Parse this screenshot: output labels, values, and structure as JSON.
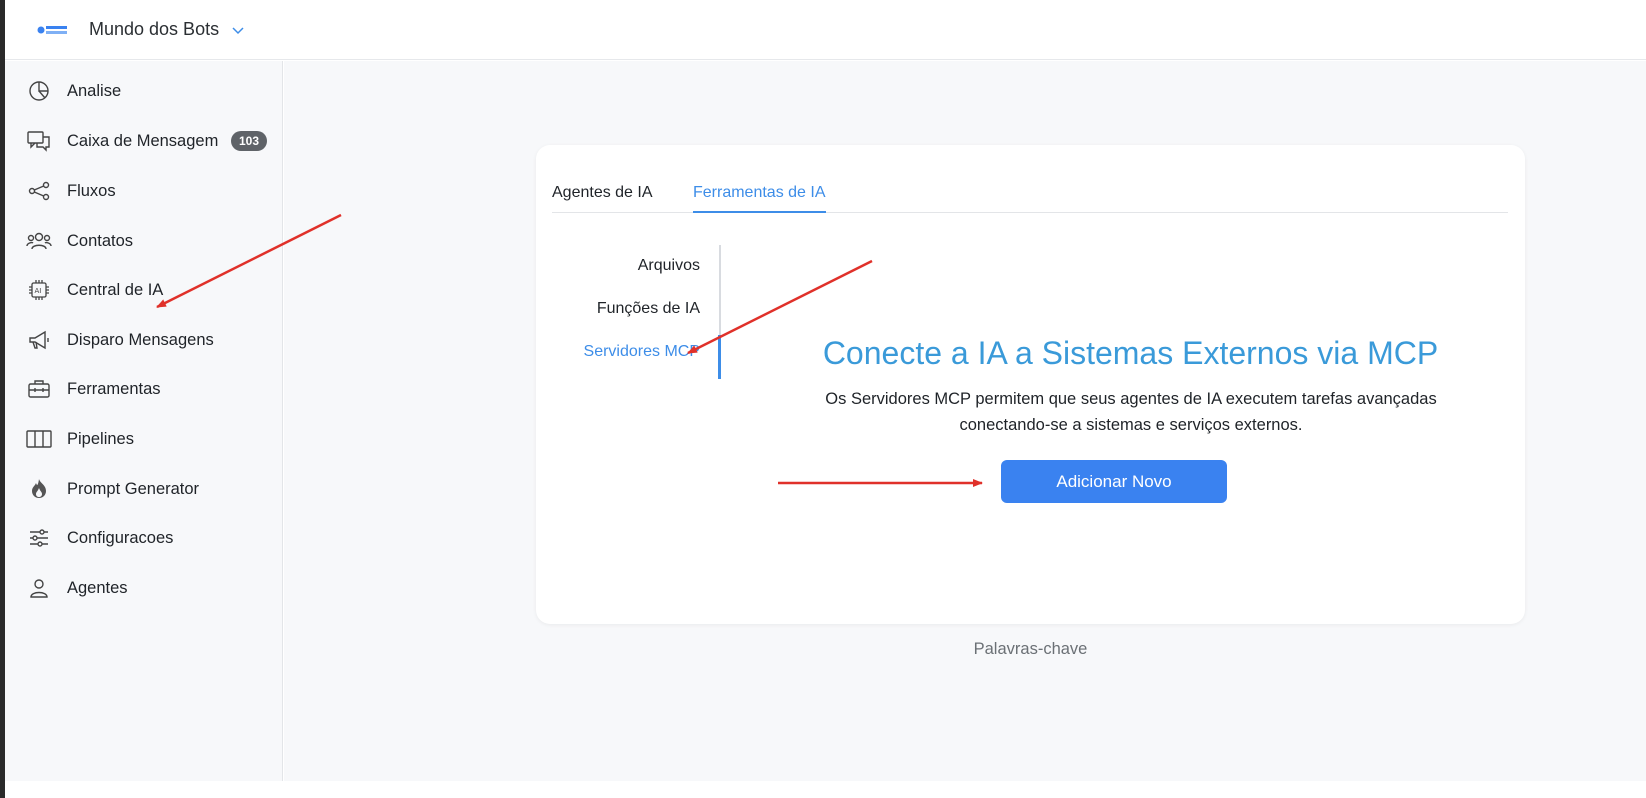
{
  "header": {
    "brand": "Mundo dos Bots",
    "logo_icon": "mundo-dos-bots-logo",
    "chevron_icon": "chevron-down-icon",
    "accent_color": "#3d8de8"
  },
  "sidebar": {
    "items": [
      {
        "label": "Analise",
        "icon": "pie-chart-icon"
      },
      {
        "label": "Caixa de Mensagem",
        "icon": "chat-bubbles-icon",
        "badge": "103"
      },
      {
        "label": "Fluxos",
        "icon": "flow-icon"
      },
      {
        "label": "Contatos",
        "icon": "contacts-icon"
      },
      {
        "label": "Central de IA",
        "icon": "ai-chip-icon"
      },
      {
        "label": "Disparo Mensagens",
        "icon": "megaphone-icon"
      },
      {
        "label": "Ferramentas",
        "icon": "toolbox-icon"
      },
      {
        "label": "Pipelines",
        "icon": "columns-icon"
      },
      {
        "label": "Prompt Generator",
        "icon": "flame-icon"
      },
      {
        "label": "Configuracoes",
        "icon": "sliders-icon"
      },
      {
        "label": "Agentes",
        "icon": "user-icon"
      }
    ]
  },
  "main": {
    "tabs": [
      {
        "label": "Agentes de IA",
        "active": false
      },
      {
        "label": "Ferramentas de IA",
        "active": true
      }
    ],
    "subnav": [
      {
        "label": "Arquivos",
        "active": false
      },
      {
        "label": "Funções de IA",
        "active": false
      },
      {
        "label": "Servidores MCP",
        "active": true
      }
    ],
    "headline": "Conecte a IA a Sistemas Externos via MCP",
    "description": "Os Servidores MCP permitem que seus agentes de IA executem tarefas avançadas conectando-se a sistemas e serviços externos.",
    "add_button": "Adicionar Novo",
    "keywords": "Palavras-chave"
  },
  "annotations": {
    "arrow_color": "#e0312a"
  }
}
